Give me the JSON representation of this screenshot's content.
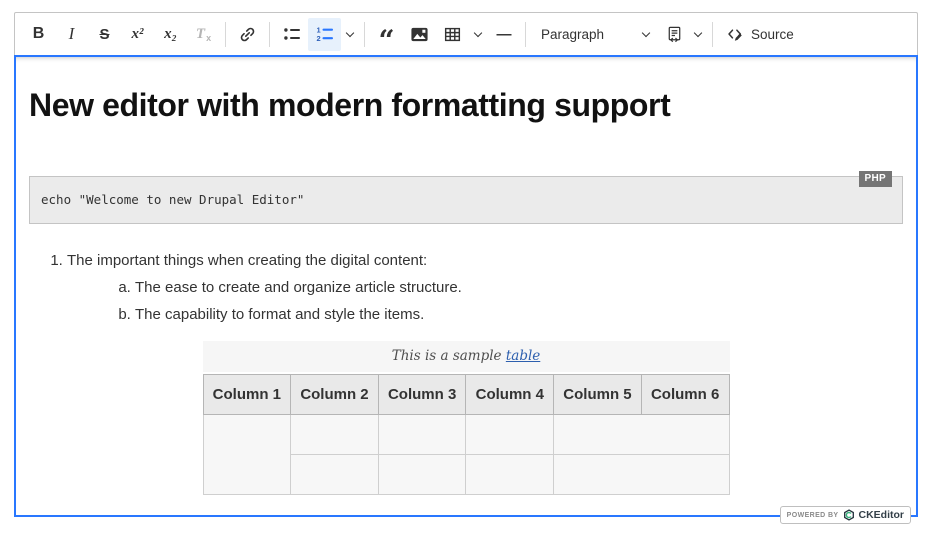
{
  "toolbar": {
    "bold": "B",
    "italic": "I",
    "strikethrough": "S",
    "superscript": "x²",
    "subscript": "x₂",
    "remove_format_main": "T",
    "remove_format_sub": "x",
    "quote": "“",
    "horizontal_line": "—",
    "paragraph_dropdown": "Paragraph",
    "source_label": "Source"
  },
  "content": {
    "heading": "New editor with modern formatting support",
    "code_block": {
      "code": "echo \"Welcome to new Drupal Editor\"",
      "language": "PHP"
    },
    "ordered_list": {
      "items": [
        {
          "text": "The important things when creating the digital content:",
          "children": [
            "The ease to create and organize article structure.",
            "The capability to format and style the items."
          ]
        }
      ]
    },
    "table": {
      "caption_text": "This is a sample ",
      "caption_link": "table",
      "headers": [
        "Column 1",
        "Column 2",
        "Column 3",
        "Column 4",
        "Column 5",
        "Column 6"
      ]
    }
  },
  "badge": {
    "powered_by": "POWERED BY",
    "brand": "CKEditor"
  },
  "colors": {
    "focus_border": "#2977ff",
    "toolbar_border": "#c4c4c4",
    "active_button_bg": "#e7f1fc",
    "active_icon_blue": "#2977ff",
    "code_block_bg": "#ebebeb",
    "code_label_bg": "#757575",
    "table_header_bg": "#e9e9e9",
    "table_cell_bg": "#f7f7f7",
    "caption_link": "#2d5fae"
  }
}
